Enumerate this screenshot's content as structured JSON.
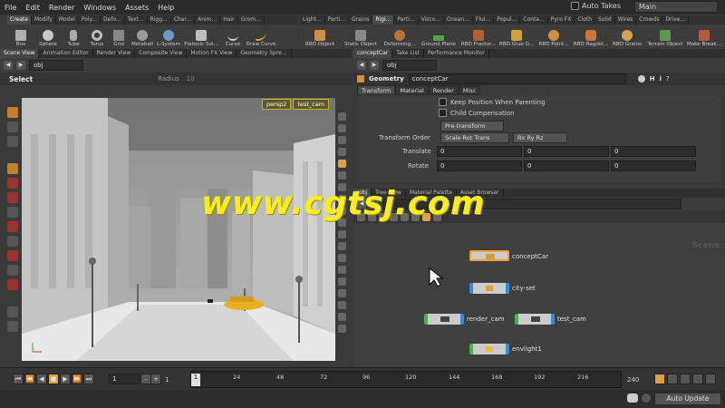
{
  "menubar": {
    "items": [
      "File",
      "Edit",
      "Render",
      "Windows",
      "Assets",
      "Help"
    ],
    "auto_takes": "Auto Takes",
    "take": "Main"
  },
  "shelf_left": {
    "tabs": [
      "Create",
      "Modify",
      "Model",
      "Poly...",
      "Defo...",
      "Text...",
      "Rigg...",
      "Char...",
      "Anim...",
      "Hair",
      "Grom..."
    ],
    "tools": [
      "Box",
      "Sphere",
      "Tube",
      "Torus",
      "Grid",
      "Metaball",
      "L-System",
      "Platonic Sol...",
      "Curve",
      "Draw Curve"
    ]
  },
  "shelf_right": {
    "tabs": [
      "Light...",
      "Parti...",
      "Grains",
      "Rigi...",
      "Parti...",
      "Visco...",
      "Ocean...",
      "Flui...",
      "Popul...",
      "Conta...",
      "Pyro FX",
      "Cloth",
      "Solid",
      "Wires",
      "Crowds",
      "Drive..."
    ],
    "tools": [
      "RBD Object",
      "Static Object",
      "Deforming...",
      "Ground Plane",
      "RBD Fractur...",
      "RBD Glue O...",
      "RBD Point...",
      "RBD Ragdol...",
      "RBD Grains",
      "Terrain Object",
      "Make Break..."
    ]
  },
  "left_panel": {
    "tabs": [
      "Scene View",
      "Animation Editor",
      "Render View",
      "Composite View",
      "Motion FX View",
      "Geometry Spre..."
    ],
    "path": "obj",
    "tool_name": "Select",
    "radius_label": "Radius",
    "radius_value": "10",
    "camera": "persp2",
    "camera2": "test_cam"
  },
  "param_panel": {
    "tabs": [
      "conceptCar",
      "Take List",
      "Performance Monitor"
    ],
    "path": "obj",
    "type": "Geometry",
    "name": "conceptCar",
    "subtabs": [
      "Transform",
      "Material",
      "Render",
      "Misc"
    ],
    "keep_position": "Keep Position When Parenting",
    "child_comp": "Child Compensation",
    "pretransform": "Pre-transform",
    "transform_order_label": "Transform Order",
    "transform_order": "Scale Rot Trans",
    "rot_order": "Rx Ry Rz",
    "translate_label": "Translate",
    "translate": [
      "0",
      "0",
      "0"
    ],
    "rotate_label": "Rotate",
    "rotate": [
      "0",
      "0",
      "0"
    ]
  },
  "network_panel": {
    "tabs": [
      "/obj",
      "Tree View",
      "Material Palette",
      "Asset Browser"
    ],
    "scene_label": "Scene",
    "nodes": [
      "conceptCar",
      "city-set",
      "render_cam",
      "test_cam",
      "envlight1"
    ]
  },
  "timeline": {
    "frame": "1",
    "start": "1",
    "current_frame_marker": "1",
    "ticks": [
      "24",
      "48",
      "72",
      "96",
      "120",
      "144",
      "168",
      "192",
      "216"
    ],
    "end": "240"
  },
  "statusbar": {
    "update_mode": "Auto Update"
  },
  "watermark": "www.cgtsj.com",
  "colors": {
    "accent_orange": "#f0a030",
    "node_blue": "#3a8ad8",
    "node_green": "#4cae4c",
    "watermark": "#f6ef1a"
  }
}
